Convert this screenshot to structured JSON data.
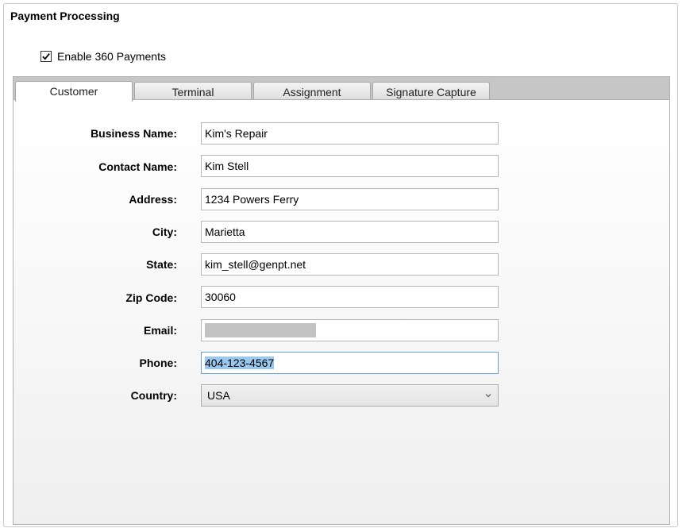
{
  "panel": {
    "title": "Payment Processing"
  },
  "enable": {
    "label": "Enable 360 Payments",
    "checked": true
  },
  "tabs": [
    {
      "label": "Customer",
      "active": true
    },
    {
      "label": "Terminal",
      "active": false
    },
    {
      "label": "Assignment",
      "active": false
    },
    {
      "label": "Signature Capture",
      "active": false
    }
  ],
  "form": {
    "business_name": {
      "label": "Business Name:",
      "value": "Kim's Repair"
    },
    "contact_name": {
      "label": "Contact Name:",
      "value": "Kim Stell"
    },
    "address": {
      "label": "Address:",
      "value": "1234 Powers Ferry"
    },
    "city": {
      "label": "City:",
      "value": "Marietta"
    },
    "state": {
      "label": "State:",
      "value": "kim_stell@genpt.net"
    },
    "zip": {
      "label": "Zip Code:",
      "value": "30060"
    },
    "email": {
      "label": "Email:",
      "value": ""
    },
    "phone": {
      "label": "Phone:",
      "value": "404-123-4567"
    },
    "country": {
      "label": "Country:",
      "value": "USA"
    }
  }
}
